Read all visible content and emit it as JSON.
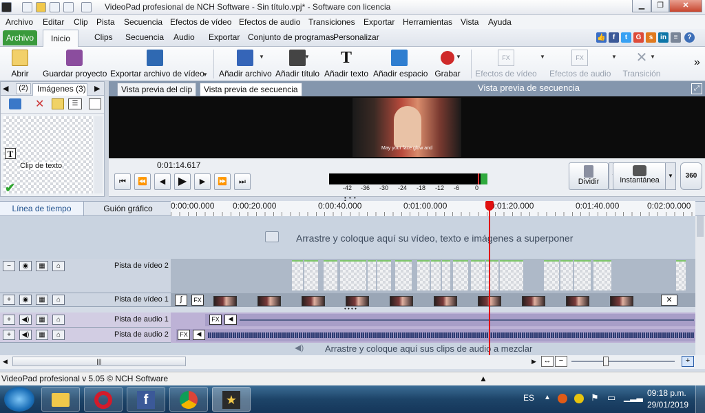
{
  "window": {
    "title": "VideoPad profesional de NCH Software - Sin título.vpj* - Software con licencia"
  },
  "menu": [
    "Archivo",
    "Editar",
    "Clip",
    "Pista",
    "Secuencia",
    "Efectos de vídeo",
    "Efectos de audio",
    "Transiciones",
    "Exportar",
    "Herramientas",
    "Vista",
    "Ayuda"
  ],
  "tabs": [
    "Archivo",
    "Inicio",
    "Clips",
    "Secuencia",
    "Audio",
    "Exportar",
    "Conjunto de programas",
    "Personalizar"
  ],
  "ribbon": {
    "abrir": "Abrir",
    "guardar": "Guardar proyecto",
    "exportar": "Exportar archivo de vídeo",
    "anadir_archivo": "Añadir archivo",
    "anadir_titulo": "Añadir título",
    "anadir_texto": "Añadir texto",
    "anadir_espacio": "Añadir espacio",
    "grabar": "Grabar",
    "efectos_video": "Efectos de vídeo",
    "efectos_audio": "Efectos de audio",
    "transicion": "Transición"
  },
  "media": {
    "tab_count": "(2)",
    "tab_label": "Imágenes (3)",
    "clip_label": "Clip de texto"
  },
  "preview": {
    "tab_clip": "Vista previa del clip",
    "tab_seq": "Vista previa de secuencia",
    "title": "Vista previa de secuencia",
    "subtitle": "May your face glow and",
    "time": "0:01:14.617",
    "meter_labels": [
      "-42",
      "-36",
      "-30",
      "-24",
      "-18",
      "-12",
      "-6",
      "0"
    ],
    "dividir": "Dividir",
    "instantanea": "Instantánea",
    "v360": "360"
  },
  "timeline": {
    "tab_linea": "Línea de tiempo",
    "tab_guion": "Guión gráfico",
    "ticks": [
      "0:00:00.000",
      "0:00:20.000",
      "0:00:40.000",
      "0:01:00.000",
      "0:01:20.000",
      "0:01:40.000",
      "0:02:00.000"
    ],
    "overlay_hint": "Arrastre y coloque aquí su vídeo, texto e imágenes a superponer",
    "track_v2": "Pista de vídeo 2",
    "track_v1": "Pista de vídeo 1",
    "track_a1": "Pista de audio 1",
    "track_a2": "Pista de audio 2",
    "audio_hint": "Arrastre y coloque aquí sus clips de audio a mezclar",
    "fx": "FX"
  },
  "status": "VideoPad profesional v 5.05 © NCH Software",
  "taskbar": {
    "lang": "ES",
    "time": "09:18 p.m.",
    "date": "29/01/2019"
  }
}
